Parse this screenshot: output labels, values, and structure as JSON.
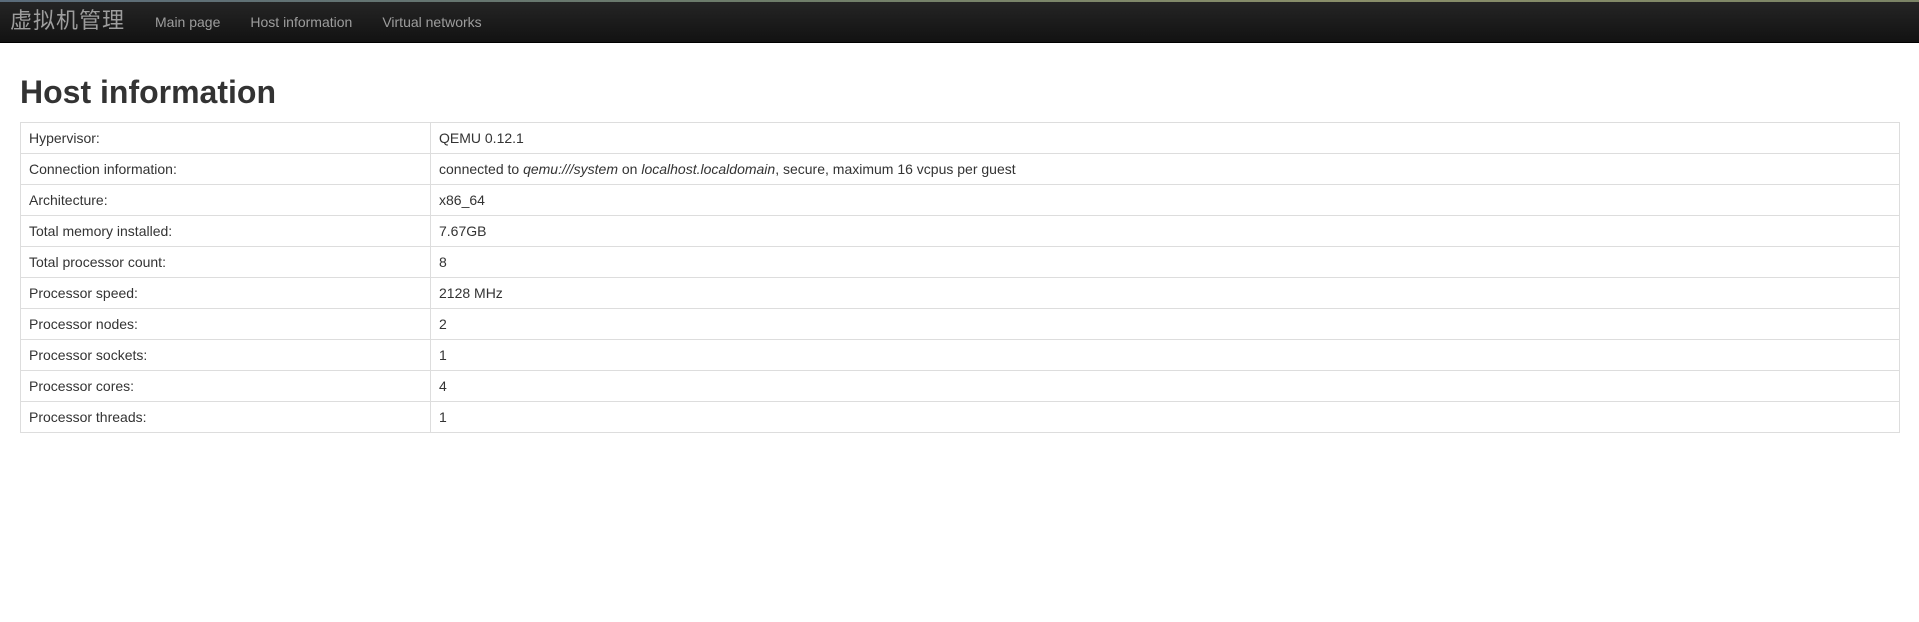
{
  "navbar": {
    "brand": "虚拟机管理",
    "items": [
      {
        "label": "Main page"
      },
      {
        "label": "Host information"
      },
      {
        "label": "Virtual networks"
      }
    ]
  },
  "page_title": "Host information",
  "rows": [
    {
      "label": "Hypervisor:",
      "value": "QEMU 0.12.1"
    },
    {
      "label": "Connection information:",
      "value_parts": {
        "prefix": "connected to ",
        "uri": "qemu:///system",
        "mid": " on ",
        "host": "localhost.localdomain",
        "suffix": ", secure, maximum 16 vcpus per guest"
      }
    },
    {
      "label": "Architecture:",
      "value": "x86_64"
    },
    {
      "label": "Total memory installed:",
      "value": "7.67GB"
    },
    {
      "label": "Total processor count:",
      "value": "8"
    },
    {
      "label": "Processor speed:",
      "value": "2128 MHz"
    },
    {
      "label": "Processor nodes:",
      "value": "2"
    },
    {
      "label": "Processor sockets:",
      "value": "1"
    },
    {
      "label": "Processor cores:",
      "value": "4"
    },
    {
      "label": "Processor threads:",
      "value": "1"
    }
  ]
}
